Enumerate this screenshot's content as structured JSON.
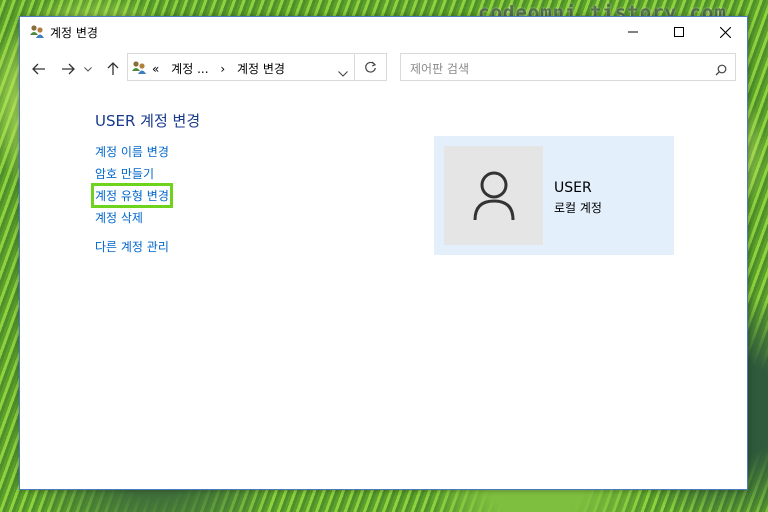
{
  "watermark": "codeomni.tistory.com",
  "window": {
    "title": "계정 변경",
    "controls": [
      "minimize",
      "maximize",
      "close"
    ]
  },
  "nav": {
    "back_icon": "back-arrow-icon",
    "forward_icon": "forward-arrow-icon",
    "recent_icon": "chevron-down-icon",
    "up_icon": "up-arrow-icon",
    "address": {
      "prefix": "«",
      "crumbs": [
        "계정 ...",
        "›",
        "계정 변경"
      ]
    },
    "refresh_icon": "refresh-icon",
    "search": {
      "placeholder": "제어판 검색"
    }
  },
  "main": {
    "heading": "USER 계정 변경",
    "links": [
      {
        "label": "계정 이름 변경",
        "highlighted": false
      },
      {
        "label": "암호 만들기",
        "highlighted": false
      },
      {
        "label": "계정 유형 변경",
        "highlighted": true
      },
      {
        "label": "계정 삭제",
        "highlighted": false
      },
      {
        "label": "다른 계정 관리",
        "highlighted": false
      }
    ]
  },
  "account": {
    "name": "USER",
    "type": "로컬 계정"
  },
  "colors": {
    "accent": "#0066cc",
    "heading": "#183a8c",
    "highlight": "#6ed31c",
    "card_bg": "#e3f0fc",
    "avatar_bg": "#e5e5e5"
  }
}
